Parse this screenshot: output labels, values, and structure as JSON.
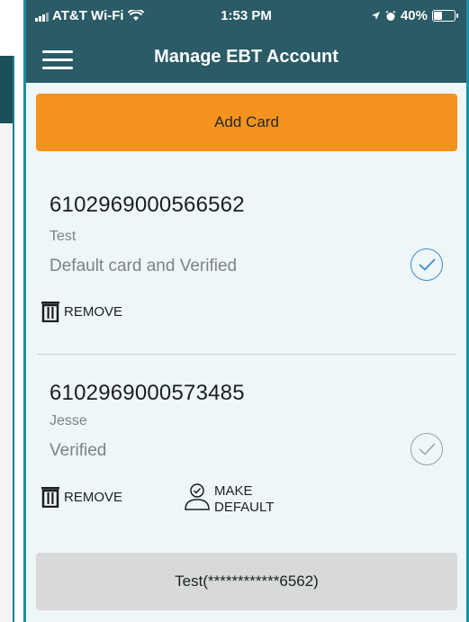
{
  "status_bar": {
    "carrier": "AT&T Wi-Fi",
    "time": "1:53 PM",
    "battery": "40%",
    "battery_level": 0.4
  },
  "header": {
    "menu_icon": "hamburger-icon",
    "title": "Manage EBT Account"
  },
  "add_card_label": "Add Card",
  "cards": [
    {
      "number": "6102969000566562",
      "name": "Test",
      "status": "Default card and Verified",
      "selected": true,
      "remove_label": "REMOVE"
    },
    {
      "number": "6102969000573485",
      "name": "Jesse",
      "status": "Verified",
      "selected": false,
      "remove_label": "REMOVE",
      "make_default_label_1": "MAKE",
      "make_default_label_2": "DEFAULT"
    }
  ],
  "footer": {
    "selected_card": "Test(************6562)"
  },
  "colors": {
    "header_bg": "#2a5b66",
    "accent": "#f6921e",
    "check_active": "#3a8ad6",
    "check_inactive": "#9aa0a3",
    "content_bg": "#eef6f7"
  }
}
